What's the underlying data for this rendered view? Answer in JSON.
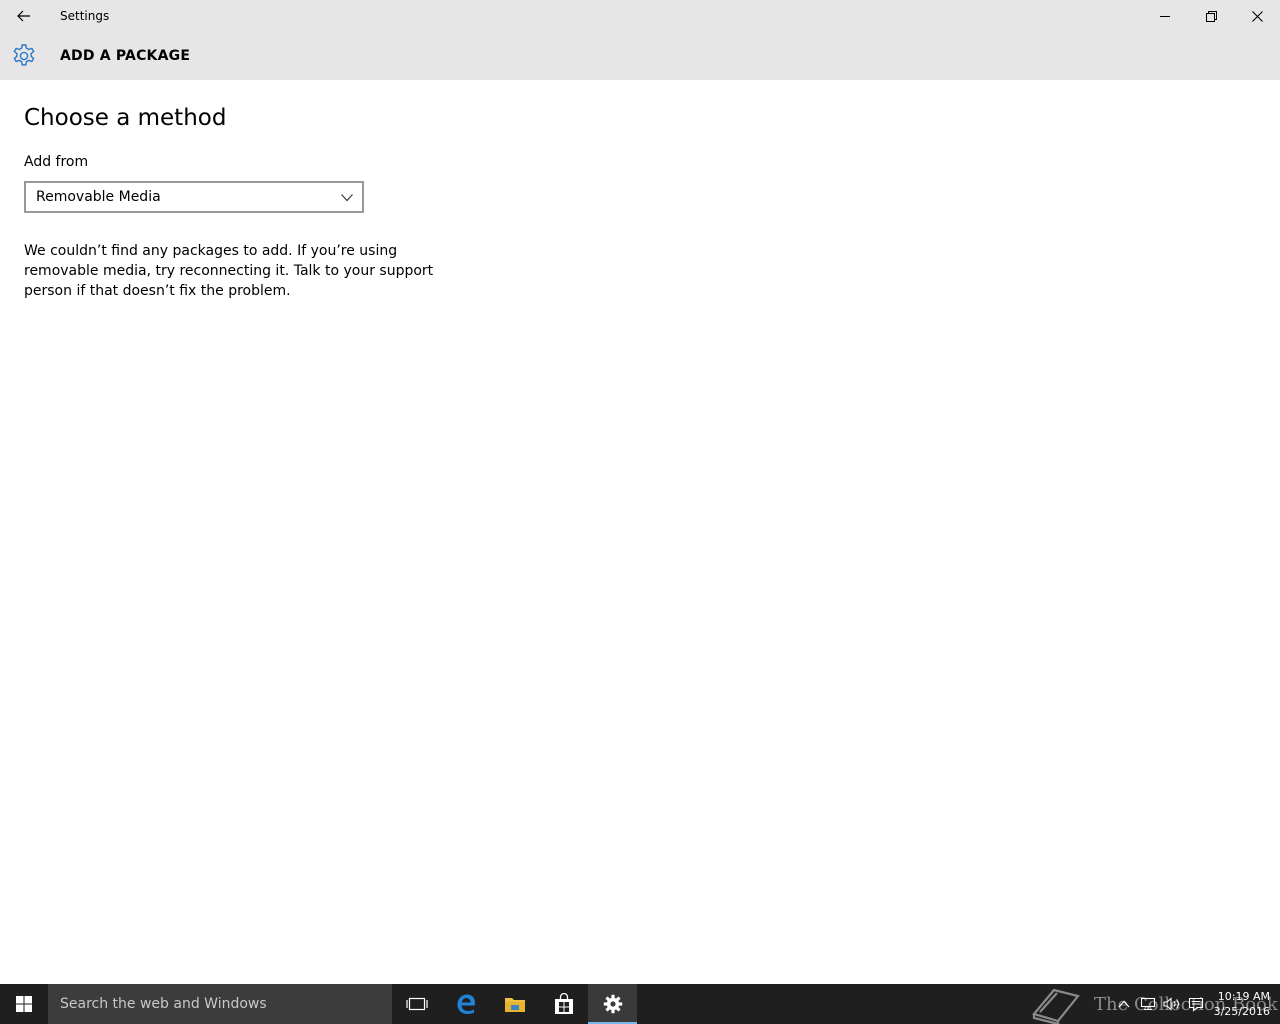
{
  "window": {
    "title": "Settings",
    "icons": [
      "back-arrow-icon",
      "minimize-icon",
      "restore-icon",
      "close-icon"
    ]
  },
  "header": {
    "title": "ADD A PACKAGE",
    "icon": "gear-icon",
    "accent_color": "#2b78c8"
  },
  "main": {
    "page_title": "Choose a method",
    "add_from_label": "Add from",
    "add_from_value": "Removable Media",
    "message": "We couldn’t find any packages to add. If you’re using removable media, try reconnecting it. Talk to your support person if that doesn’t fix the problem."
  },
  "taskbar": {
    "search_placeholder": "Search the web and Windows",
    "apps": [
      "task-view-icon",
      "edge-icon",
      "file-explorer-icon",
      "store-icon",
      "settings-icon"
    ],
    "active_app": "settings-icon",
    "watermark": "The Collection Book",
    "tray_icons": [
      "chevron-up-icon",
      "network-icon",
      "volume-icon",
      "action-center-icon"
    ],
    "time": "10:19 AM",
    "date": "3/25/2016",
    "colors": {
      "background": "#1f1f1f",
      "active_indicator": "#76b9ed"
    }
  }
}
